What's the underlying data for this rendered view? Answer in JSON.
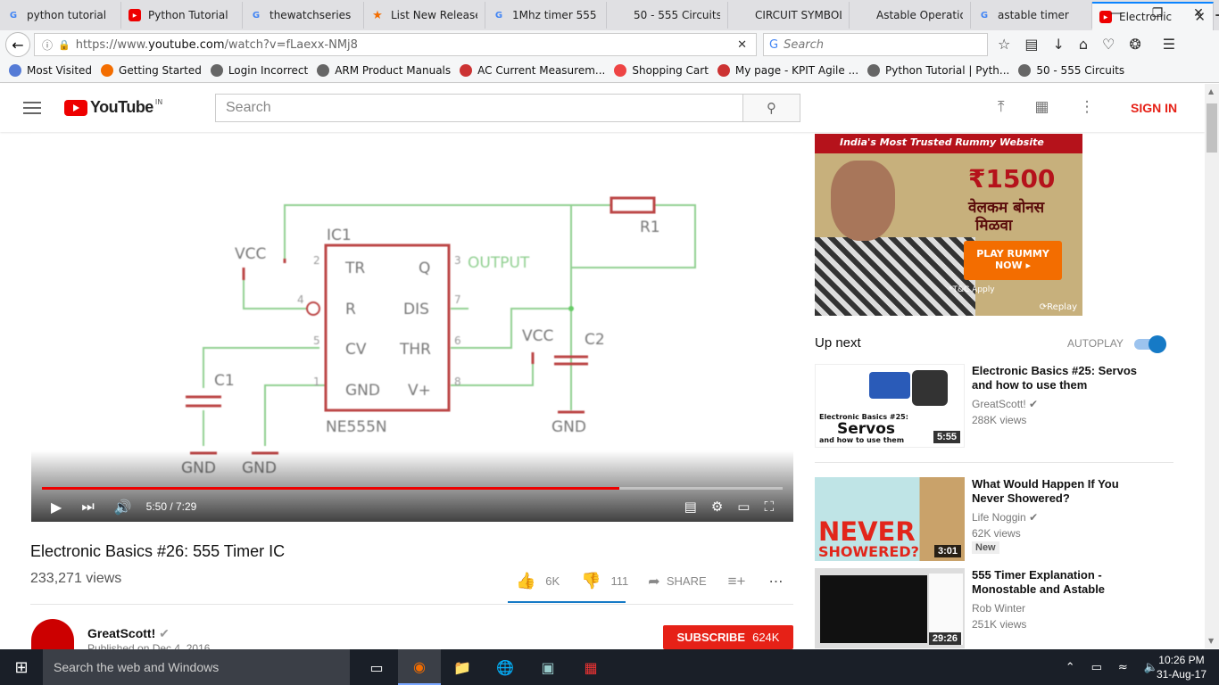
{
  "browser": {
    "tabs": [
      {
        "label": "python tutorial",
        "icon": "google-icon"
      },
      {
        "label": "Python Tutorial",
        "icon": "youtube-icon"
      },
      {
        "label": "thewatchseries",
        "icon": "google-icon"
      },
      {
        "label": "List New Releases",
        "icon": "movie-icon"
      },
      {
        "label": "1Mhz timer 555",
        "icon": "google-icon"
      },
      {
        "label": "50 - 555 Circuits",
        "icon": "page-icon"
      },
      {
        "label": "CIRCUIT SYMBOLS",
        "icon": "page-icon"
      },
      {
        "label": "Astable Operation",
        "icon": "page-icon"
      },
      {
        "label": "astable timer",
        "icon": "google-icon"
      },
      {
        "label": "Electronic",
        "icon": "youtube-icon",
        "active": true
      }
    ],
    "url_prefix": "https://www.",
    "url_domain": "youtube.com",
    "url_path": "/watch?v=fLaexx-NMj8",
    "search_placeholder": "Search",
    "bookmarks": [
      "Most Visited",
      "Getting Started",
      "Login Incorrect",
      "ARM Product Manuals",
      "AC Current Measurem...",
      "Shopping Cart",
      "My page - KPIT Agile ...",
      "Python Tutorial | Pyth...",
      "50 - 555 Circuits"
    ]
  },
  "youtube": {
    "logo_text": "YouTube",
    "region": "IN",
    "search_placeholder": "Search",
    "sign_in": "SIGN IN"
  },
  "video": {
    "title": "Electronic Basics #26: 555 Timer IC",
    "views": "233,271 views",
    "time": "5:50 / 7:29",
    "progress": 0.78,
    "likes": "6K",
    "dislikes": "111",
    "share": "SHARE",
    "channel": "GreatScott!",
    "published": "Published on Dec 4, 2016",
    "subscribe": "SUBSCRIBE",
    "subscribers": "624K",
    "schematic": {
      "ic": "IC1",
      "part": "NE555N",
      "pins": [
        "TR",
        "Q",
        "R",
        "DIS",
        "CV",
        "THR",
        "GND",
        "V+"
      ],
      "pin_numbers": [
        "2",
        "3",
        "4",
        "7",
        "5",
        "6",
        "1",
        "8"
      ],
      "labels": {
        "vcc1": "VCC",
        "vcc2": "VCC",
        "output": "OUTPUT",
        "r1": "R1",
        "c1": "C1",
        "c2": "C2",
        "gnd": "GND"
      }
    }
  },
  "ad": {
    "top": "India's Most Trusted Rummy Website",
    "amount": "₹1500",
    "line1": "वेलकम बोनस",
    "line2": "मिळवा",
    "cta": "PLAY RUMMY NOW ▸",
    "tc": "*T&C Apply",
    "replay": "Replay"
  },
  "sidebar": {
    "up_next": "Up next",
    "autoplay": "AUTOPLAY",
    "autoplay_on": true,
    "videos": [
      {
        "title": "Electronic Basics #25: Servos and how to use them",
        "channel": "GreatScott!",
        "views": "288K views",
        "duration": "5:55",
        "thumb_text": "Electronic Basics #25:",
        "thumb_big": "Servos",
        "thumb_sub": "and how to use them"
      },
      {
        "title": "What Would Happen If You Never Showered?",
        "channel": "Life Noggin",
        "views": "62K views",
        "duration": "3:01",
        "badge": "New",
        "thumb_big": "NEVER",
        "thumb_sub": "SHOWERED?"
      },
      {
        "title": "555 Timer Explanation - Monostable and Astable",
        "channel": "Rob Winter",
        "views": "251K views",
        "duration": "29:26"
      }
    ]
  },
  "taskbar": {
    "search_placeholder": "Search the web and Windows",
    "time": "10:26 PM",
    "date": "31-Aug-17"
  }
}
